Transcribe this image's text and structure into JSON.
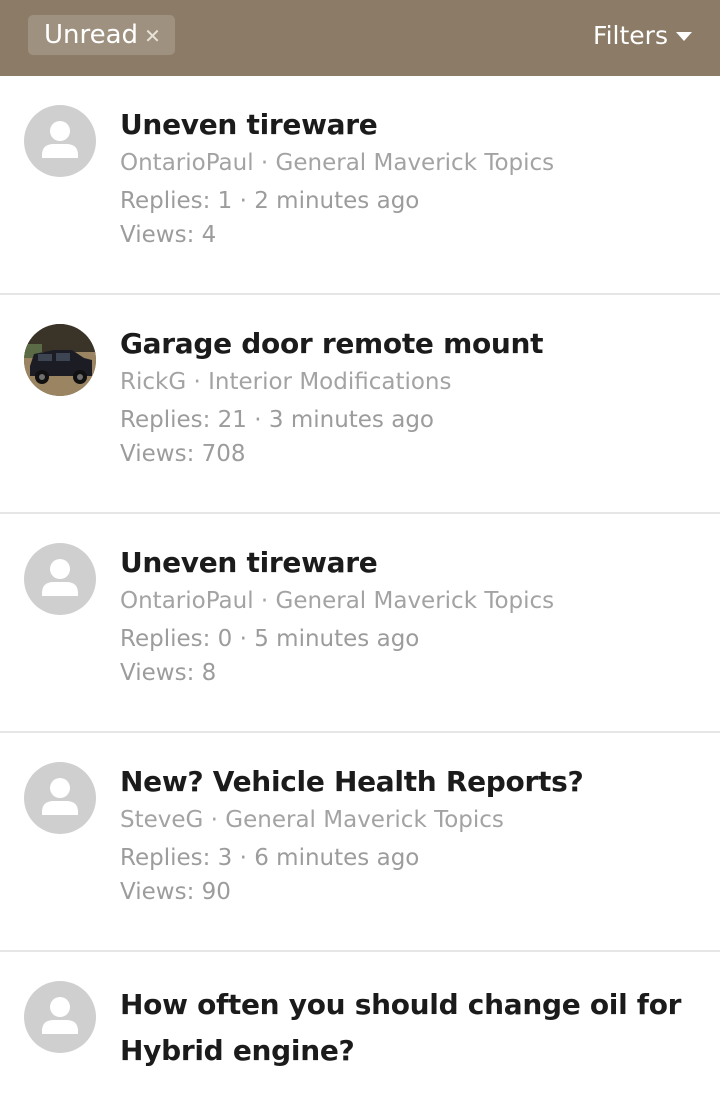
{
  "header": {
    "unread_chip": "Unread",
    "chip_close_icon": "close-icon",
    "filters_label": "Filters",
    "filters_icon": "caret-down-icon",
    "background": "#8b7b67"
  },
  "threads": [
    {
      "title": "Uneven tireware",
      "author": "OntarioPaul",
      "forum": "General Maverick Topics",
      "replies_text": "Replies: 1 · 2 minutes ago",
      "views_text": "Views: 4",
      "avatar": "default-user-icon"
    },
    {
      "title": "Garage door remote mount",
      "author": "RickG",
      "forum": "Interior Modifications",
      "replies_text": "Replies: 21  · 3 minutes ago",
      "views_text": "Views: 708",
      "avatar": "truck-photo-avatar"
    },
    {
      "title": "Uneven tireware",
      "author": "OntarioPaul",
      "forum": "General Maverick Topics",
      "replies_text": "Replies: 0 · 5 minutes ago",
      "views_text": "Views: 8",
      "avatar": "default-user-icon"
    },
    {
      "title": "New? Vehicle Health Reports?",
      "author": "SteveG",
      "forum": "General Maverick Topics",
      "replies_text": "Replies: 3 · 6 minutes ago",
      "views_text": "Views: 90",
      "avatar": "default-user-icon"
    },
    {
      "title": "How often you should change oil for Hybrid engine?",
      "avatar": "default-user-icon"
    }
  ],
  "separator": " · "
}
